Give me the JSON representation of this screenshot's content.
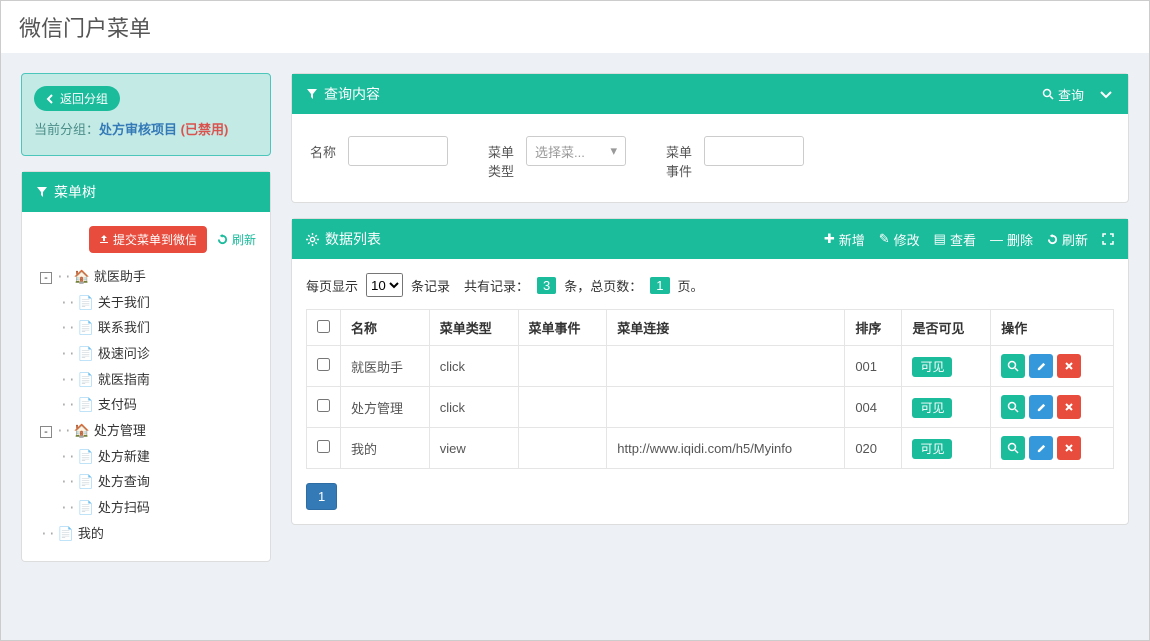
{
  "page_title": "微信门户菜单",
  "back_box": {
    "back_label": "返回分组",
    "group_label": "当前分组：",
    "group_name": "处方审核项目",
    "disabled_text": "(已禁用)"
  },
  "tree_panel": {
    "title": "菜单树",
    "submit_label": "提交菜单到微信",
    "refresh_label": "刷新",
    "nodes": [
      {
        "label": "就医助手",
        "children": [
          "关于我们",
          "联系我们",
          "极速问诊",
          "就医指南",
          "支付码"
        ]
      },
      {
        "label": "处方管理",
        "children": [
          "处方新建",
          "处方查询",
          "处方扫码"
        ]
      },
      {
        "label": "我的",
        "children": []
      }
    ]
  },
  "filter_panel": {
    "title": "查询内容",
    "query_label": "查询",
    "fields": {
      "name_label": "名称",
      "type_label": "菜单\n类型",
      "type_placeholder": "选择菜...",
      "event_label": "菜单\n事件"
    }
  },
  "list_panel": {
    "title": "数据列表",
    "actions": {
      "add": "新增",
      "edit": "修改",
      "view": "查看",
      "delete": "删除",
      "refresh": "刷新"
    },
    "paging": {
      "per_page_prefix": "每页显示",
      "per_page_value": "10",
      "per_page_suffix": "条记录",
      "total_prefix": "共有记录：",
      "total_count": "3",
      "total_mid": "条，总页数：",
      "total_pages": "1",
      "total_suffix": "页。"
    },
    "columns": [
      "名称",
      "菜单类型",
      "菜单事件",
      "菜单连接",
      "排序",
      "是否可见",
      "操作"
    ],
    "rows": [
      {
        "name": "就医助手",
        "type": "click",
        "event": "",
        "link": "",
        "sort": "001",
        "visible": "可见"
      },
      {
        "name": "处方管理",
        "type": "click",
        "event": "",
        "link": "",
        "sort": "004",
        "visible": "可见"
      },
      {
        "name": "我的",
        "type": "view",
        "event": "",
        "link": "http://www.iqidi.com/h5/Myinfo",
        "sort": "020",
        "visible": "可见"
      }
    ],
    "current_page": "1"
  }
}
